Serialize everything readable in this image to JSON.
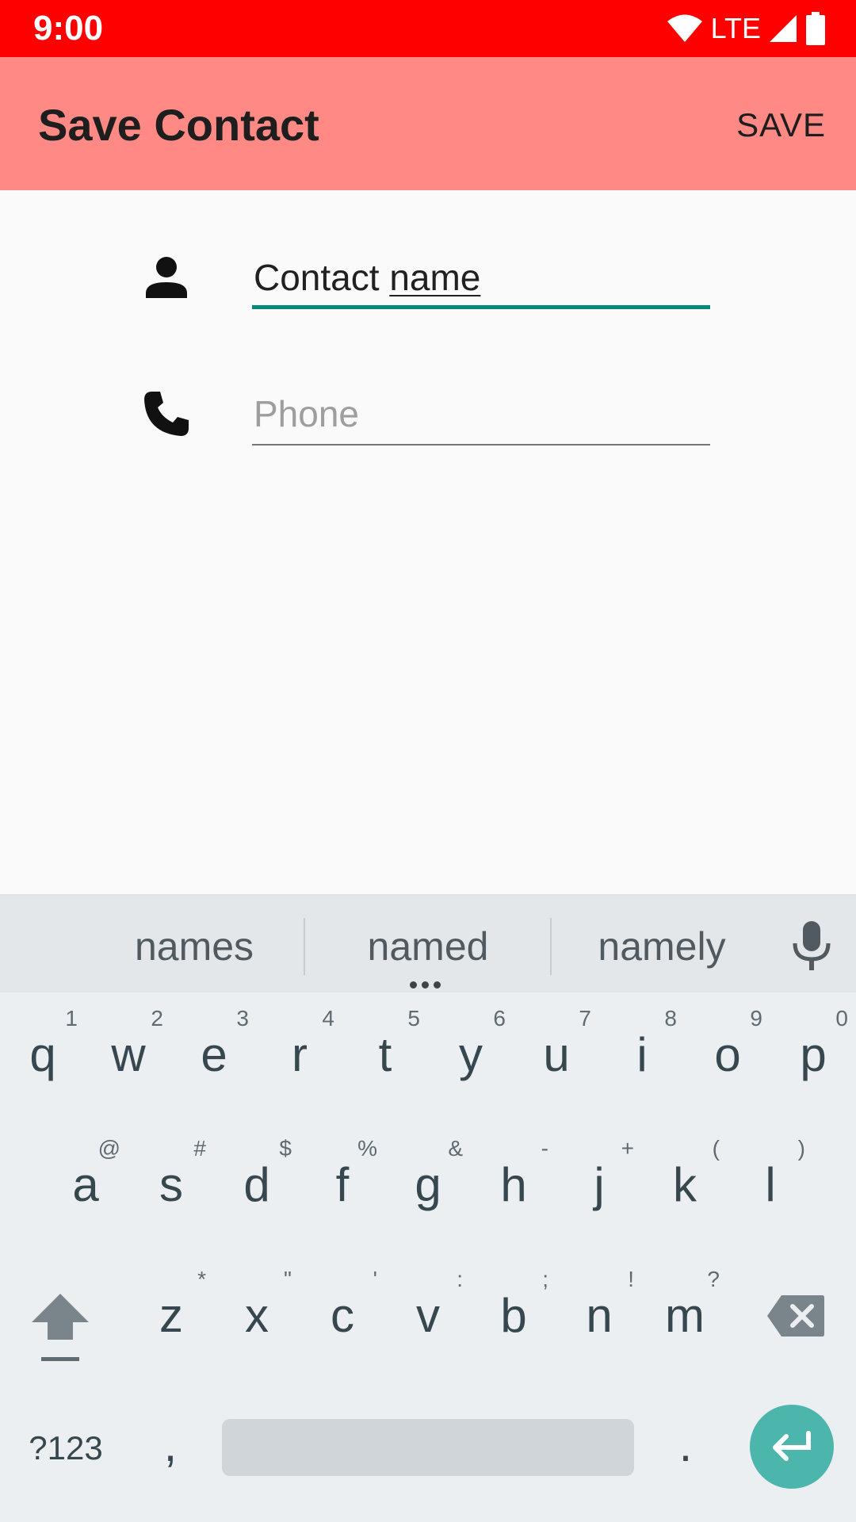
{
  "status_bar": {
    "time": "9:00",
    "network": "LTE",
    "icons": [
      "wifi-icon",
      "cell-signal-icon",
      "battery-icon"
    ],
    "color": "#ff0000"
  },
  "app_bar": {
    "title": "Save Contact",
    "action_label": "SAVE",
    "color": "#ff8a85"
  },
  "form": {
    "name_field": {
      "icon": "person-icon",
      "value_prefix": "Contact ",
      "value_composing": "name",
      "focused": true,
      "accent_color": "#00897b"
    },
    "phone_field": {
      "icon": "phone-icon",
      "placeholder": "Phone",
      "value": ""
    }
  },
  "keyboard": {
    "suggestions": [
      "names",
      "named",
      "namely"
    ],
    "row1": [
      {
        "key": "q",
        "hint": "1"
      },
      {
        "key": "w",
        "hint": "2"
      },
      {
        "key": "e",
        "hint": "3"
      },
      {
        "key": "r",
        "hint": "4"
      },
      {
        "key": "t",
        "hint": "5"
      },
      {
        "key": "y",
        "hint": "6"
      },
      {
        "key": "u",
        "hint": "7"
      },
      {
        "key": "i",
        "hint": "8"
      },
      {
        "key": "o",
        "hint": "9"
      },
      {
        "key": "p",
        "hint": "0"
      }
    ],
    "row2": [
      {
        "key": "a",
        "hint": "@"
      },
      {
        "key": "s",
        "hint": "#"
      },
      {
        "key": "d",
        "hint": "$"
      },
      {
        "key": "f",
        "hint": "%"
      },
      {
        "key": "g",
        "hint": "&"
      },
      {
        "key": "h",
        "hint": "-"
      },
      {
        "key": "j",
        "hint": "+"
      },
      {
        "key": "k",
        "hint": "("
      },
      {
        "key": "l",
        "hint": ")"
      }
    ],
    "row3": [
      {
        "key": "z",
        "hint": "*"
      },
      {
        "key": "x",
        "hint": "\""
      },
      {
        "key": "c",
        "hint": "'"
      },
      {
        "key": "v",
        "hint": ":"
      },
      {
        "key": "b",
        "hint": ";"
      },
      {
        "key": "n",
        "hint": "!"
      },
      {
        "key": "m",
        "hint": "?"
      }
    ],
    "symbols_label": "?123",
    "comma_label": ",",
    "period_label": ".",
    "enter_color": "#4db6ac"
  }
}
